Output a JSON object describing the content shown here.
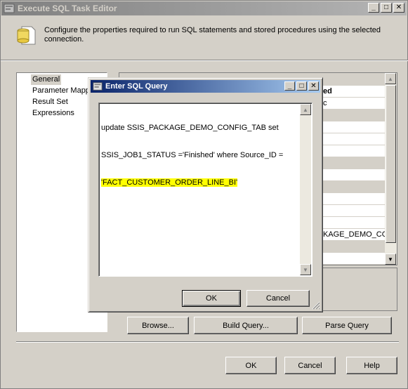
{
  "window": {
    "title": "Execute SQL Task Editor",
    "min": "_",
    "max": "□",
    "close": "✕"
  },
  "header": {
    "description": "Configure the properties required to run SQL statements and stored procedures using the selected connection."
  },
  "nav": {
    "items": [
      "General",
      "Parameter Mapp",
      "Result Set",
      "Expressions"
    ]
  },
  "grid_fragments": {
    "bold_fragment": "ed",
    "row_fragment_1": "c",
    "package_fragment": "KAGE_DEMO_CO"
  },
  "buttons": {
    "browse": "Browse...",
    "build_query": "Build Query...",
    "parse_query": "Parse Query",
    "ok": "OK",
    "cancel": "Cancel",
    "help": "Help"
  },
  "dialog": {
    "title": "Enter SQL Query",
    "sql_line_1": "update SSIS_PACKAGE_DEMO_CONFIG_TAB set",
    "sql_line_2": "SSIS_JOB1_STATUS ='Finished' where Source_ID =",
    "sql_line_3": "'FACT_CUSTOMER_ORDER_LINE_BI'",
    "ok": "OK",
    "cancel": "Cancel",
    "highlight_color": "#ffff00"
  }
}
